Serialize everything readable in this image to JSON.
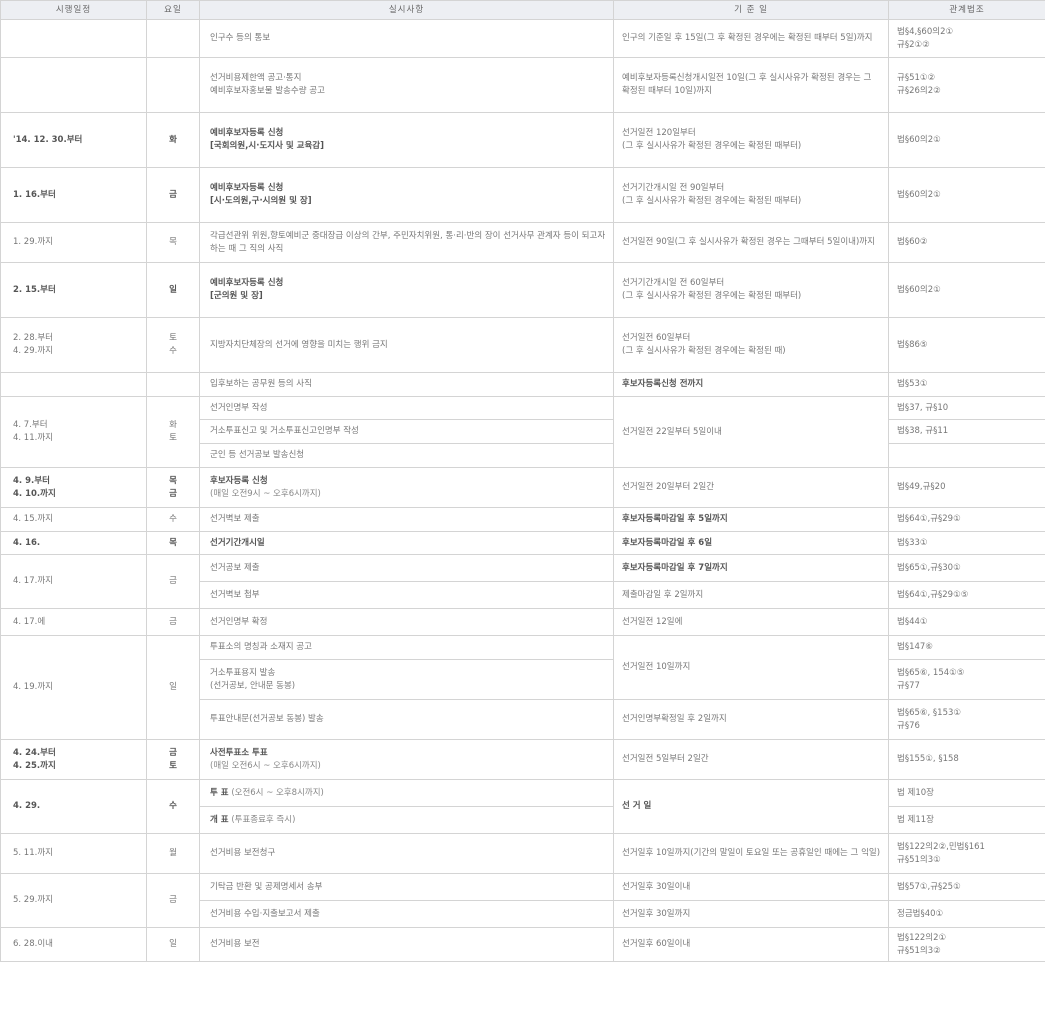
{
  "headers": [
    "시행일정",
    "요일",
    "실시사항",
    "기 준 일",
    "관계법조"
  ],
  "rows": [
    {
      "period": [],
      "day": [],
      "activity": [
        "인구수 등의 통보"
      ],
      "standard": [
        "인구의 기준일 후 15일(그 후 확정된 경우에는 확정된 때부터 5일)까지"
      ],
      "law": [
        "법§4,§60의2①",
        "규§2①②"
      ]
    },
    {
      "period": [],
      "day": [],
      "activity": [
        "선거비용제한액 공고·통지",
        "예비후보자홍보물 발송수량 공고"
      ],
      "standard": [
        "예비후보자등록신청개시일전 10일(그 후 실시사유가 확정된 경우는 그 확정된 때부터 10일)까지"
      ],
      "law": [
        "규§51①②",
        "규§26의2②"
      ]
    },
    {
      "period": [
        "'14. 12. 30.부터"
      ],
      "day": [
        "화"
      ],
      "activity": [
        "예비후보자등록 신청",
        "[국회의원,시·도지사 및 교육감]"
      ],
      "activity_note": [],
      "standard": [
        "선거일전 120일부터",
        "(그 후 실시사유가 확정된 경우에는 확정된 때부터)"
      ],
      "law": [
        "법§60의2①"
      ],
      "bold": true
    },
    {
      "period": [
        "1. 16.부터"
      ],
      "day": [
        "금"
      ],
      "activity": [
        "예비후보자등록 신청",
        "[시·도의원,구·시의원 및 장]"
      ],
      "activity_note": [],
      "standard": [
        "선거기간개시일 전 90일부터",
        "(그 후 실시사유가 확정된 경우에는 확정된 때부터)"
      ],
      "law": [
        "법§60의2①"
      ],
      "bold": true
    },
    {
      "period": [
        "1. 29.까지"
      ],
      "day": [
        "목"
      ],
      "activity": [
        "각급선관위 위원,향토예비군 중대장급 이상의 간부, 주민자치위원, 통·리·반의 장이 선거사무 관계자 등이 되고자 하는 때 그 직의 사직"
      ],
      "standard": [
        "선거일전 90일(그 후 실시사유가 확정된 경우는 그때부터 5일이내)까지"
      ],
      "law": [
        "법§60②"
      ]
    },
    {
      "period": [
        "2. 15.부터"
      ],
      "day": [
        "일"
      ],
      "activity": [
        "예비후보자등록 신청",
        "[군의원 및 장]"
      ],
      "activity_note": [],
      "standard": [
        "선거기간개시일 전 60일부터",
        "(그 후 실시사유가 확정된 경우에는 확정된 때부터)"
      ],
      "law": [
        "법§60의2①"
      ],
      "bold": true
    },
    {
      "period": [
        "2. 28.부터",
        "4. 29.까지"
      ],
      "day": [
        "토",
        "수"
      ],
      "activity": [
        "지방자치단체장의 선거에 영향을 미치는 행위 금지"
      ],
      "standard": [
        "선거일전 60일부터",
        "(그 후 실시사유가 확정된 경우에는 확정된 때)"
      ],
      "law": [
        "법§86⑤"
      ]
    }
  ],
  "group_1": {
    "row_a": {
      "activity": "입후보하는 공무원 등의 사직",
      "standard": "후보자등록신청 전까지",
      "law": "법§53①"
    }
  },
  "group_2": {
    "period": [
      "4. 7.부터",
      "4. 11.까지"
    ],
    "day": [
      "화",
      "토"
    ],
    "standard": "선거일전 22일부터 5일이내",
    "row_a": {
      "activity": "선거인명부 작성",
      "law": "법§37, 규§10"
    },
    "row_b": {
      "activity": "거소투표신고 및 거소투표신고인명부 작성",
      "law": "법§38, 규§11"
    },
    "row_c": {
      "activity": "군인 등 선거공보 발송신청",
      "law": ""
    }
  },
  "group_3": {
    "row_a": {
      "period": [
        "4. 9.부터",
        "4. 10.까지"
      ],
      "day": [
        "목",
        "금"
      ],
      "activity": "후보자등록 신청",
      "activity_note": "(매일 오전9시 ~ 오후6시까지)",
      "standard": "선거일전 20일부터 2일간",
      "law": "법§49,규§20"
    },
    "row_b": {
      "period": "4. 15.까지",
      "day": "수",
      "activity": "선거벽보 제출",
      "standard": "후보자등록마감일 후 5일까지",
      "law": "법§64①,규§29①"
    },
    "row_c": {
      "period": "4. 16.",
      "day": "목",
      "activity": "선거기간개시일",
      "standard": "후보자등록마감일 후 6일",
      "law": "법§33①"
    }
  },
  "group_4": {
    "period": "4. 17.까지",
    "day": "금",
    "row_a": {
      "activity": "선거공보 제출",
      "standard": "후보자등록마감일 후 7일까지",
      "law": "법§65①,규§30①"
    },
    "row_b": {
      "activity": "선거벽보 첩부",
      "standard": "제출마감일 후 2일까지",
      "law": "법§64①,규§29①⑤"
    }
  },
  "group_5": {
    "period": "4. 17.에",
    "day": "금",
    "activity": "선거인명부 확정",
    "standard": "선거일전 12일에",
    "law": "법§44①"
  },
  "group_6": {
    "period": "4. 19.까지",
    "day": "일",
    "row_a": {
      "activity": "투표소의 명칭과 소재지 공고",
      "law": "법§147⑥"
    },
    "row_b": {
      "activity": "거소투표용지 발송",
      "activity_note": "(선거공보, 안내문 동봉)",
      "law": [
        "법§65⑥, 154①⑤",
        "규§77"
      ]
    },
    "row_c": {
      "activity": "투표안내문(선거공보 동봉) 발송",
      "standard": "선거인명부확정일 후 2일까지",
      "law": [
        "법§65⑥, §153①",
        "규§76"
      ]
    },
    "standard_ab": "선거일전 10일까지"
  },
  "group_7": {
    "period": [
      "4. 24.부터",
      "4. 25.까지"
    ],
    "day": [
      "금",
      "토"
    ],
    "activity": "사전투표소 투표",
    "activity_note": "(매일 오전6시 ~ 오후6시까지)",
    "standard": "선거일전 5일부터 2일간",
    "law": "법§155①, §158"
  },
  "group_8": {
    "period": "4. 29.",
    "day": "수",
    "row_a": {
      "activity": "투 표",
      "activity_note": "(오전6시 ~ 오후8시까지)",
      "law": "법 제10장"
    },
    "row_b": {
      "activity": "개 표",
      "activity_note": "(투표종료후 즉시)",
      "law": "법 제11장"
    },
    "standard": "선 거 일"
  },
  "group_9": {
    "period": "5. 11.까지",
    "day": "월",
    "activity": "선거비용 보전청구",
    "standard": "선거일후 10일까지(기간의 말일이 토요일 또는 공휴일인 때에는 그 익일)",
    "law": [
      "법§122의2②,민법§161",
      "규§51의3①"
    ]
  },
  "group_10": {
    "period": "5. 29.까지",
    "day": "금",
    "row_a": {
      "activity": "기탁금 반환 및 공제명세서 송부",
      "standard": "선거일후 30일이내",
      "law": "법§57①,규§25①"
    },
    "row_b": {
      "activity": "선거비용 수입·지출보고서 제출",
      "standard": "선거일후 30일까지",
      "law": "정금법§40①"
    }
  },
  "group_11": {
    "period": "6. 28.이내",
    "day": "일",
    "activity": "선거비용 보전",
    "standard": "선거일후 60일이내",
    "law": [
      "법§122의2①",
      "규§51의3②"
    ]
  }
}
